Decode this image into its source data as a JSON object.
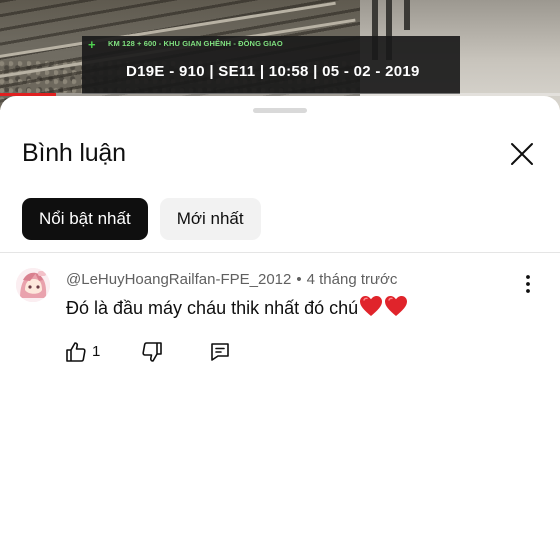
{
  "video": {
    "overlay_location": "KM 128 + 600 - KHU GIAN GHÊNH - ĐỒNG GIAO",
    "overlay_stamp": "D19E - 910 | SE11 | 10:58 | 05 - 02 - 2019",
    "progress_fraction": 0.1,
    "progress_color": "#e02020"
  },
  "comments_panel": {
    "title": "Bình luận",
    "close_icon": "close-icon",
    "filter_chips": [
      {
        "label": "Nổi bật nhất",
        "active": true
      },
      {
        "label": "Mới nhất",
        "active": false
      }
    ]
  },
  "comments": [
    {
      "author": "@LeHuyHoangRailfan-FPE_2012",
      "separator": "•",
      "time": "4 tháng trước",
      "text": "Đó là đầu máy cháu thik nhất đó chú",
      "emoji_icons": [
        "heart-icon",
        "heart-icon"
      ],
      "like_count": "1",
      "avatar_icon": "avatar-anime-character",
      "more_icon": "more-vertical-icon"
    }
  ],
  "colors": {
    "accent_red": "#e02020",
    "chip_active_bg": "#0f0f0f",
    "chip_inactive_bg": "#f2f2f2",
    "heart_red": "#e0242b"
  }
}
